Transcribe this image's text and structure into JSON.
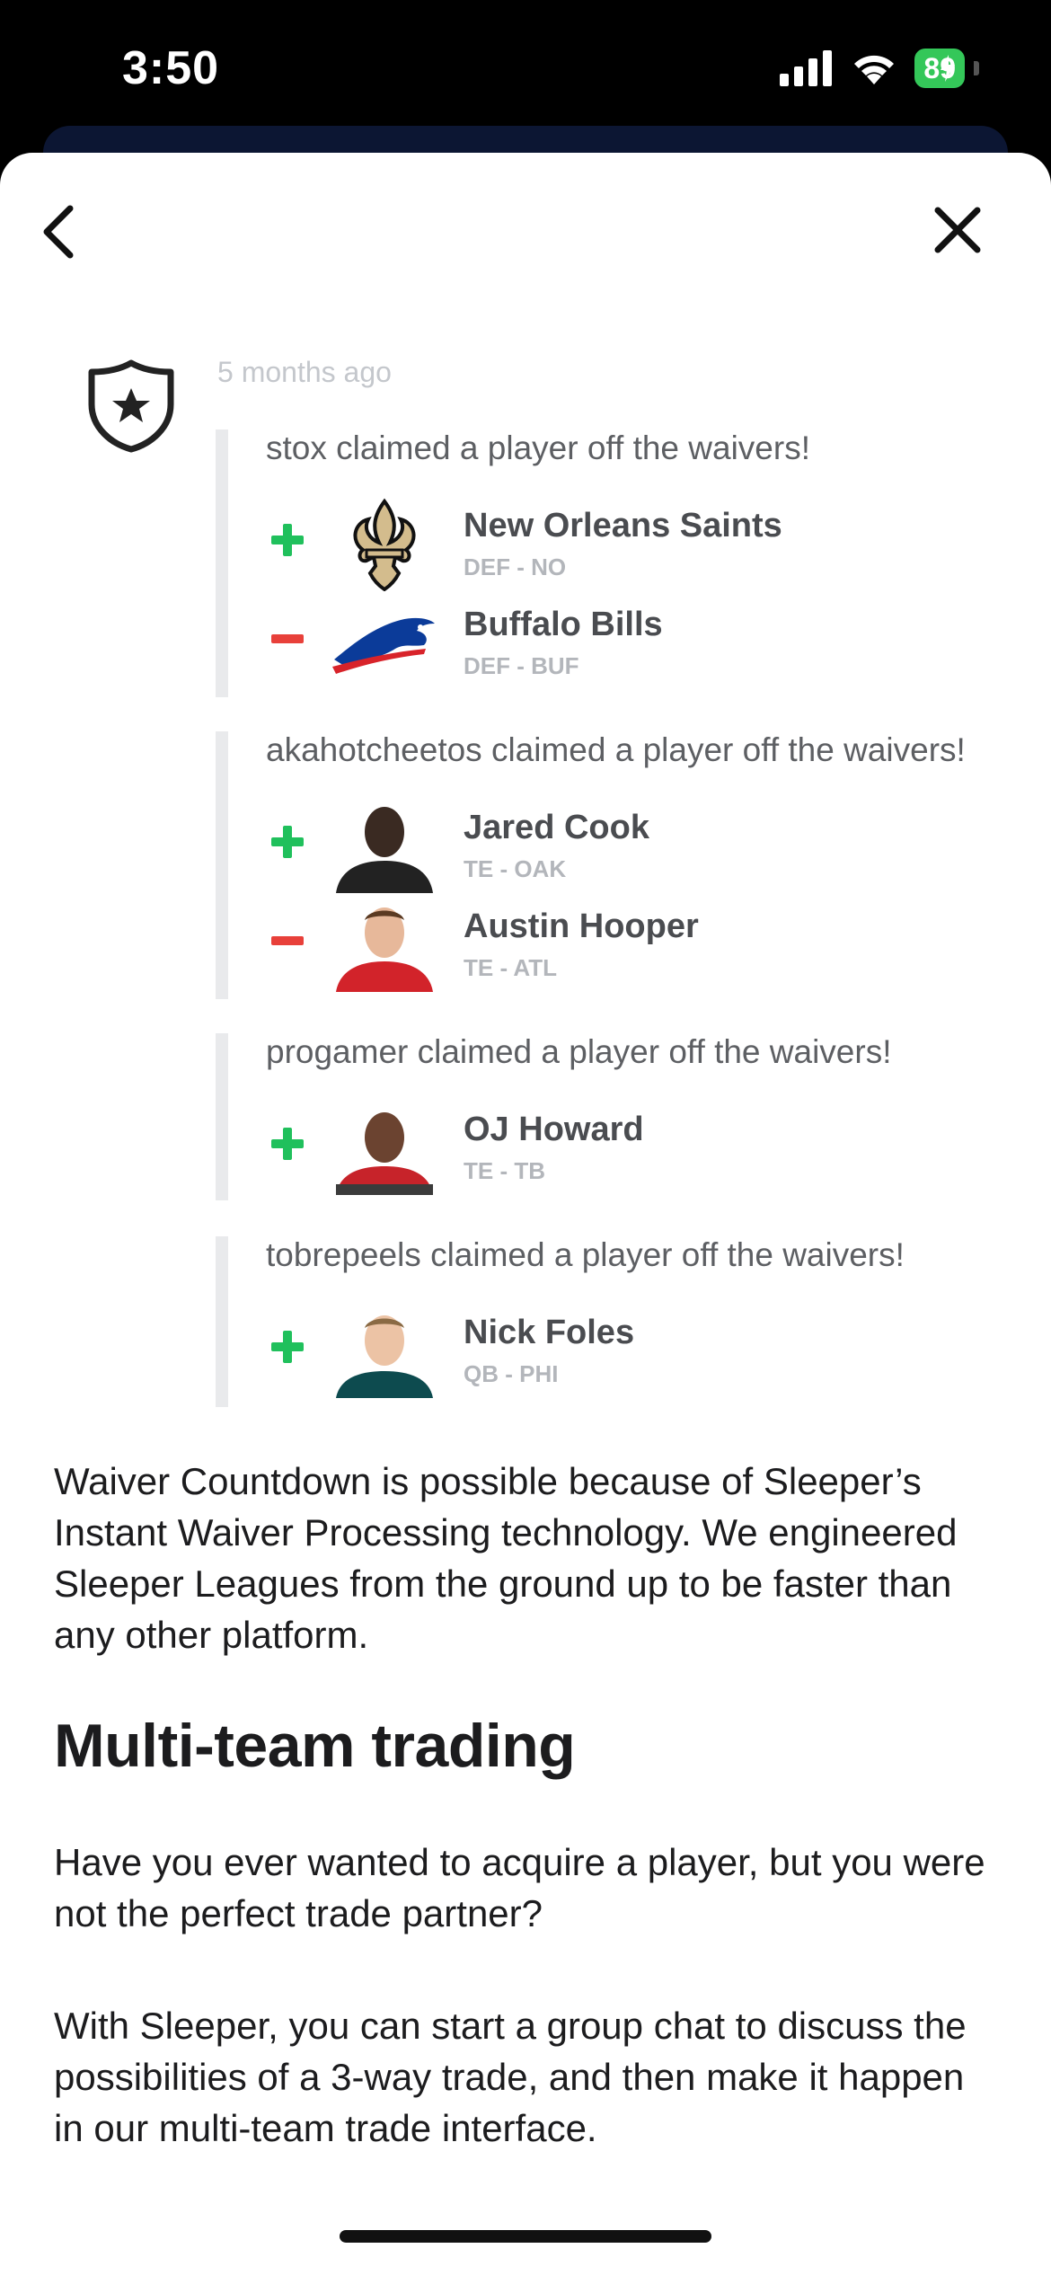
{
  "status_bar": {
    "time": "3:50",
    "battery": "89"
  },
  "feed": {
    "time_ago": "5 months ago",
    "groups": [
      {
        "title": "stox claimed a player off the waivers!",
        "players": [
          {
            "action": "add",
            "name": "New Orleans Saints",
            "position": "DEF - NO",
            "avatar": "saints-logo"
          },
          {
            "action": "drop",
            "name": "Buffalo Bills",
            "position": "DEF - BUF",
            "avatar": "bills-logo"
          }
        ]
      },
      {
        "title": "akahotcheetos claimed a player off the waivers!",
        "players": [
          {
            "action": "add",
            "name": "Jared Cook",
            "position": "TE - OAK",
            "avatar": "player-photo"
          },
          {
            "action": "drop",
            "name": "Austin Hooper",
            "position": "TE - ATL",
            "avatar": "player-photo"
          }
        ]
      },
      {
        "title": "progamer claimed a player off the waivers!",
        "players": [
          {
            "action": "add",
            "name": "OJ Howard",
            "position": "TE - TB",
            "avatar": "player-photo"
          }
        ]
      },
      {
        "title": "tobrepeels claimed a player off the waivers!",
        "players": [
          {
            "action": "add",
            "name": "Nick Foles",
            "position": "QB - PHI",
            "avatar": "player-photo"
          }
        ]
      }
    ]
  },
  "article": {
    "waiver_paragraph": "Waiver Countdown is possible because of Sleeper’s Instant Waiver Processing technology. We engineered Sleeper Leagues from the ground up to be faster than any other platform.",
    "heading": "Multi-team trading",
    "paragraph_1": "Have you ever wanted to acquire a player, but you were not the perfect trade partner?",
    "paragraph_2": "With Sleeper, you can start a group chat to discuss the possibilities of a 3-way trade, and then make it happen in our multi-team trade interface."
  },
  "colors": {
    "add": "#20c05c",
    "drop": "#e8403a",
    "battery": "#34c759"
  }
}
